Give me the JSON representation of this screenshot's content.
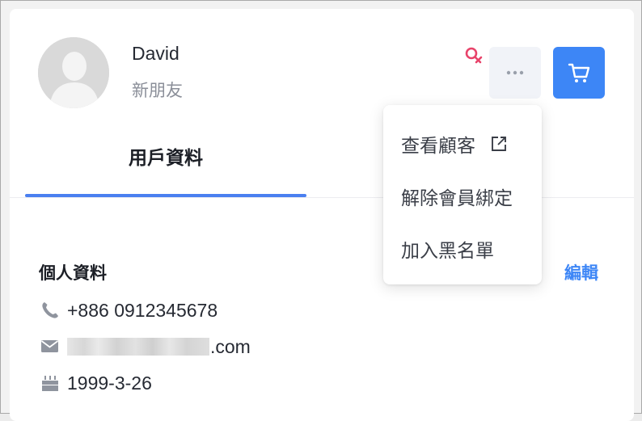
{
  "profile": {
    "name": "David",
    "tag": "新朋友",
    "gender_icon": "female-icon",
    "gender_color": "#e8436a"
  },
  "actions": {
    "more_icon": "ellipsis-icon",
    "cart_icon": "cart-icon",
    "accent": "#3d86f6"
  },
  "tabs": [
    {
      "label": "用戶資料",
      "active": true
    }
  ],
  "menu": {
    "items": [
      {
        "label": "查看顧客",
        "icon": "external-link-icon"
      },
      {
        "label": "解除會員綁定"
      },
      {
        "label": "加入黑名單"
      }
    ]
  },
  "personal": {
    "title": "個人資料",
    "edit_label": "編輯",
    "phone": "+886 0912345678",
    "email_suffix": ".com",
    "birthday": "1999-3-26"
  }
}
